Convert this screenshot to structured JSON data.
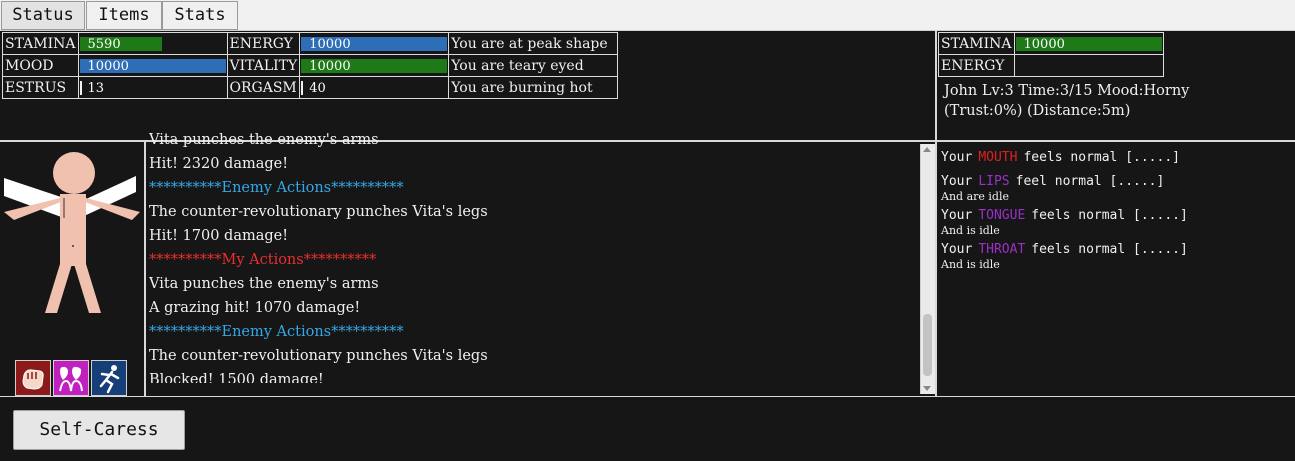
{
  "tabs": [
    {
      "label": "Status",
      "active": true
    },
    {
      "label": "Items",
      "active": false
    },
    {
      "label": "Stats",
      "active": false
    }
  ],
  "player_stats": {
    "rows": [
      {
        "label1": "STAMINA",
        "value1": "5590",
        "fill1": 0.56,
        "color1": "green",
        "label2": "ENERGY",
        "value2": "10000",
        "fill2": 1.0,
        "color2": "blue",
        "status": "You are at peak shape"
      },
      {
        "label1": "MOOD",
        "value1": "10000",
        "fill1": 1.0,
        "color1": "blue",
        "label2": "VITALITY",
        "value2": "10000",
        "fill2": 1.0,
        "color2": "green",
        "status": "You are teary eyed"
      },
      {
        "label1": "ESTRUS",
        "value1": "13",
        "fill1": 0,
        "color1": "",
        "label2": "ORGASM",
        "value2": "40",
        "fill2": 0,
        "color2": "",
        "status": "You are burning hot"
      }
    ]
  },
  "enemy_stats": {
    "stamina_label": "STAMINA",
    "stamina_value": "10000",
    "energy_label": "ENERGY",
    "line1": "John Lv:3 Time:3/15 Mood:Horny",
    "line2": "(Trust:0%) (Distance:5m)"
  },
  "log": [
    {
      "text": "Vita punches the enemy's arms",
      "color": "#f0f0f0"
    },
    {
      "text": "Hit! 2320 damage!",
      "color": "#f0f0f0"
    },
    {
      "text": "**********Enemy Actions**********",
      "color": "#35a8e8"
    },
    {
      "text": "The counter-revolutionary punches Vita's legs",
      "color": "#f0f0f0"
    },
    {
      "text": "Hit! 1700 damage!",
      "color": "#f0f0f0"
    },
    {
      "text": "**********My Actions**********",
      "color": "#e83030"
    },
    {
      "text": "Vita punches the enemy's arms",
      "color": "#f0f0f0"
    },
    {
      "text": "A grazing hit! 1070 damage!",
      "color": "#f0f0f0"
    },
    {
      "text": "**********Enemy Actions**********",
      "color": "#35a8e8"
    },
    {
      "text": "The counter-revolutionary punches Vita's legs",
      "color": "#f0f0f0"
    },
    {
      "text": "Blocked! 1500 damage!",
      "color": "#f0f0f0"
    }
  ],
  "body_parts": [
    {
      "prefix": "Your",
      "part": "MOUTH",
      "color": "#e02020",
      "state": "feels normal [.....]",
      "sub": ""
    },
    {
      "prefix": "Your",
      "part": "LIPS",
      "color": "#9b30c8",
      "state": "feel normal [.....]",
      "sub": "And are idle"
    },
    {
      "prefix": "Your",
      "part": "TONGUE",
      "color": "#9b30c8",
      "state": "feels normal [.....]",
      "sub": "And is idle"
    },
    {
      "prefix": "Your",
      "part": "THROAT",
      "color": "#9b30c8",
      "state": "feels normal [.....]",
      "sub": "And is idle"
    }
  ],
  "action_button": "Self-Caress",
  "icons": [
    "fist-icon",
    "hearts-couple-icon",
    "running-figure-icon"
  ]
}
